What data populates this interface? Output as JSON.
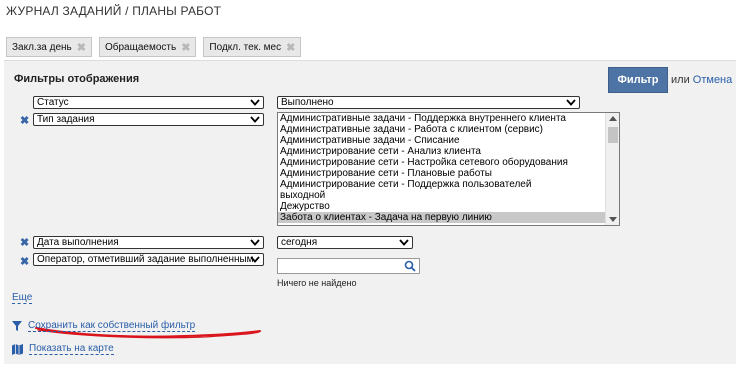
{
  "page_title": "ЖУРНАЛ ЗАДАНИЙ / ПЛАНЫ РАБОТ",
  "saved_filters": [
    {
      "label": "Закл.за день"
    },
    {
      "label": "Обращаемость"
    },
    {
      "label": "Подкл. тек. мес"
    }
  ],
  "panel": {
    "title": "Фильтры отображения",
    "filter_button": "Фильтр",
    "or_text": "или",
    "cancel_link": "Отмена"
  },
  "filters": {
    "status_field": "Статус",
    "status_value": "Выполнено",
    "task_type_field": "Тип задания",
    "task_type_options": [
      "Административные задачи - Поддержка внутреннего клиента",
      "Административные задачи - Работа с клиентом (сервис)",
      "Административные задачи - Списание",
      "Администрирование сети - Анализ клиента",
      "Администрирование сети - Настройка сетевого оборудования",
      "Администрирование сети - Плановые работы",
      "Администрирование сети - Поддержка пользователей",
      "выходной",
      "Дежурство",
      "Забота о клиентах - Задача на первую линию"
    ],
    "task_type_selected": "Забота о клиентах - Задача на первую линию",
    "date_field": "Дата выполнения",
    "date_value": "сегодня",
    "operator_field": "Оператор, отметивший задание выполненным",
    "operator_search_value": "",
    "operator_not_found": "Ничего не найдено"
  },
  "links": {
    "more": "Еще",
    "save_filter": "Сохранить как собственный фильтр",
    "show_on_map": "Показать на карте"
  },
  "colors": {
    "accent": "#4e73a5",
    "link": "#2a5ea8",
    "annotation": "#d9141b",
    "panel_bg": "#f1f1f1"
  },
  "icons": {
    "chip_remove": "close-icon",
    "row_remove": "close-icon",
    "dropdown": "chevron-down-icon",
    "search": "search-icon",
    "save_filter": "funnel-icon",
    "map": "map-icon"
  }
}
